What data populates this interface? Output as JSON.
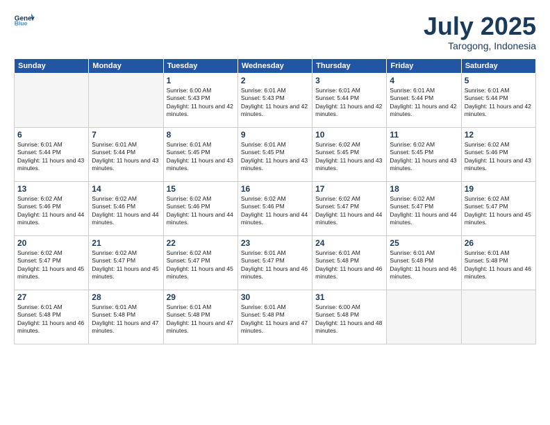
{
  "logo": {
    "general": "General",
    "blue": "Blue",
    "tagline": ""
  },
  "title": "July 2025",
  "location": "Tarogong, Indonesia",
  "days_header": [
    "Sunday",
    "Monday",
    "Tuesday",
    "Wednesday",
    "Thursday",
    "Friday",
    "Saturday"
  ],
  "weeks": [
    [
      {
        "day": "",
        "info": ""
      },
      {
        "day": "",
        "info": ""
      },
      {
        "day": "1",
        "sunrise": "Sunrise: 6:00 AM",
        "sunset": "Sunset: 5:43 PM",
        "daylight": "Daylight: 11 hours and 42 minutes."
      },
      {
        "day": "2",
        "sunrise": "Sunrise: 6:01 AM",
        "sunset": "Sunset: 5:43 PM",
        "daylight": "Daylight: 11 hours and 42 minutes."
      },
      {
        "day": "3",
        "sunrise": "Sunrise: 6:01 AM",
        "sunset": "Sunset: 5:44 PM",
        "daylight": "Daylight: 11 hours and 42 minutes."
      },
      {
        "day": "4",
        "sunrise": "Sunrise: 6:01 AM",
        "sunset": "Sunset: 5:44 PM",
        "daylight": "Daylight: 11 hours and 42 minutes."
      },
      {
        "day": "5",
        "sunrise": "Sunrise: 6:01 AM",
        "sunset": "Sunset: 5:44 PM",
        "daylight": "Daylight: 11 hours and 42 minutes."
      }
    ],
    [
      {
        "day": "6",
        "sunrise": "Sunrise: 6:01 AM",
        "sunset": "Sunset: 5:44 PM",
        "daylight": "Daylight: 11 hours and 43 minutes."
      },
      {
        "day": "7",
        "sunrise": "Sunrise: 6:01 AM",
        "sunset": "Sunset: 5:44 PM",
        "daylight": "Daylight: 11 hours and 43 minutes."
      },
      {
        "day": "8",
        "sunrise": "Sunrise: 6:01 AM",
        "sunset": "Sunset: 5:45 PM",
        "daylight": "Daylight: 11 hours and 43 minutes."
      },
      {
        "day": "9",
        "sunrise": "Sunrise: 6:01 AM",
        "sunset": "Sunset: 5:45 PM",
        "daylight": "Daylight: 11 hours and 43 minutes."
      },
      {
        "day": "10",
        "sunrise": "Sunrise: 6:02 AM",
        "sunset": "Sunset: 5:45 PM",
        "daylight": "Daylight: 11 hours and 43 minutes."
      },
      {
        "day": "11",
        "sunrise": "Sunrise: 6:02 AM",
        "sunset": "Sunset: 5:45 PM",
        "daylight": "Daylight: 11 hours and 43 minutes."
      },
      {
        "day": "12",
        "sunrise": "Sunrise: 6:02 AM",
        "sunset": "Sunset: 5:46 PM",
        "daylight": "Daylight: 11 hours and 43 minutes."
      }
    ],
    [
      {
        "day": "13",
        "sunrise": "Sunrise: 6:02 AM",
        "sunset": "Sunset: 5:46 PM",
        "daylight": "Daylight: 11 hours and 44 minutes."
      },
      {
        "day": "14",
        "sunrise": "Sunrise: 6:02 AM",
        "sunset": "Sunset: 5:46 PM",
        "daylight": "Daylight: 11 hours and 44 minutes."
      },
      {
        "day": "15",
        "sunrise": "Sunrise: 6:02 AM",
        "sunset": "Sunset: 5:46 PM",
        "daylight": "Daylight: 11 hours and 44 minutes."
      },
      {
        "day": "16",
        "sunrise": "Sunrise: 6:02 AM",
        "sunset": "Sunset: 5:46 PM",
        "daylight": "Daylight: 11 hours and 44 minutes."
      },
      {
        "day": "17",
        "sunrise": "Sunrise: 6:02 AM",
        "sunset": "Sunset: 5:47 PM",
        "daylight": "Daylight: 11 hours and 44 minutes."
      },
      {
        "day": "18",
        "sunrise": "Sunrise: 6:02 AM",
        "sunset": "Sunset: 5:47 PM",
        "daylight": "Daylight: 11 hours and 44 minutes."
      },
      {
        "day": "19",
        "sunrise": "Sunrise: 6:02 AM",
        "sunset": "Sunset: 5:47 PM",
        "daylight": "Daylight: 11 hours and 45 minutes."
      }
    ],
    [
      {
        "day": "20",
        "sunrise": "Sunrise: 6:02 AM",
        "sunset": "Sunset: 5:47 PM",
        "daylight": "Daylight: 11 hours and 45 minutes."
      },
      {
        "day": "21",
        "sunrise": "Sunrise: 6:02 AM",
        "sunset": "Sunset: 5:47 PM",
        "daylight": "Daylight: 11 hours and 45 minutes."
      },
      {
        "day": "22",
        "sunrise": "Sunrise: 6:02 AM",
        "sunset": "Sunset: 5:47 PM",
        "daylight": "Daylight: 11 hours and 45 minutes."
      },
      {
        "day": "23",
        "sunrise": "Sunrise: 6:01 AM",
        "sunset": "Sunset: 5:47 PM",
        "daylight": "Daylight: 11 hours and 46 minutes."
      },
      {
        "day": "24",
        "sunrise": "Sunrise: 6:01 AM",
        "sunset": "Sunset: 5:48 PM",
        "daylight": "Daylight: 11 hours and 46 minutes."
      },
      {
        "day": "25",
        "sunrise": "Sunrise: 6:01 AM",
        "sunset": "Sunset: 5:48 PM",
        "daylight": "Daylight: 11 hours and 46 minutes."
      },
      {
        "day": "26",
        "sunrise": "Sunrise: 6:01 AM",
        "sunset": "Sunset: 5:48 PM",
        "daylight": "Daylight: 11 hours and 46 minutes."
      }
    ],
    [
      {
        "day": "27",
        "sunrise": "Sunrise: 6:01 AM",
        "sunset": "Sunset: 5:48 PM",
        "daylight": "Daylight: 11 hours and 46 minutes."
      },
      {
        "day": "28",
        "sunrise": "Sunrise: 6:01 AM",
        "sunset": "Sunset: 5:48 PM",
        "daylight": "Daylight: 11 hours and 47 minutes."
      },
      {
        "day": "29",
        "sunrise": "Sunrise: 6:01 AM",
        "sunset": "Sunset: 5:48 PM",
        "daylight": "Daylight: 11 hours and 47 minutes."
      },
      {
        "day": "30",
        "sunrise": "Sunrise: 6:01 AM",
        "sunset": "Sunset: 5:48 PM",
        "daylight": "Daylight: 11 hours and 47 minutes."
      },
      {
        "day": "31",
        "sunrise": "Sunrise: 6:00 AM",
        "sunset": "Sunset: 5:48 PM",
        "daylight": "Daylight: 11 hours and 48 minutes."
      },
      {
        "day": "",
        "info": ""
      },
      {
        "day": "",
        "info": ""
      }
    ]
  ]
}
